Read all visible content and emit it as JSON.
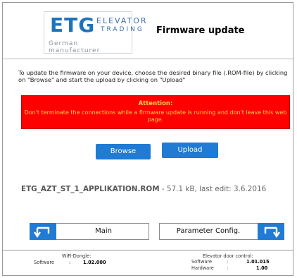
{
  "header": {
    "logo": {
      "brand": "ETG",
      "line1": "ELEVATOR",
      "line2": "TRADING",
      "tagline": "German manufacturer"
    },
    "title": "Firmware update"
  },
  "intro_text": "To update the firmware on your device, choose the desired binary file (.ROM-file) by clicking on \"Browse\" and start the upload by clicking on \"Upload\"",
  "attention": {
    "title": "Attention:",
    "message": "Don't terminate the connections while a firmware update is running and don't leave this web page."
  },
  "buttons": {
    "browse": "Browse",
    "upload": "Upload"
  },
  "file": {
    "name": "ETG_AZT_ST_1_APPLIKATION.ROM",
    "meta": " - 57.1 kB, last edit: 3.6.2016"
  },
  "nav": {
    "main": "Main",
    "parameter": "Parameter Config."
  },
  "footer": {
    "wifi": {
      "title": "WiFi-Dongle:",
      "software_label": "Software",
      "software_value": "1.02.000"
    },
    "door": {
      "title": "Elevator door control:",
      "software_label": "Software",
      "software_value": "1.01.015",
      "hardware_label": "Hardware",
      "hardware_value": "1.00"
    }
  },
  "colors": {
    "accent_blue": "#1f7bd4",
    "alert_red": "#ff0000",
    "alert_text": "#ffd24d"
  },
  "icons": {
    "back": "return-left-arrow-icon",
    "forward": "return-right-arrow-icon"
  }
}
